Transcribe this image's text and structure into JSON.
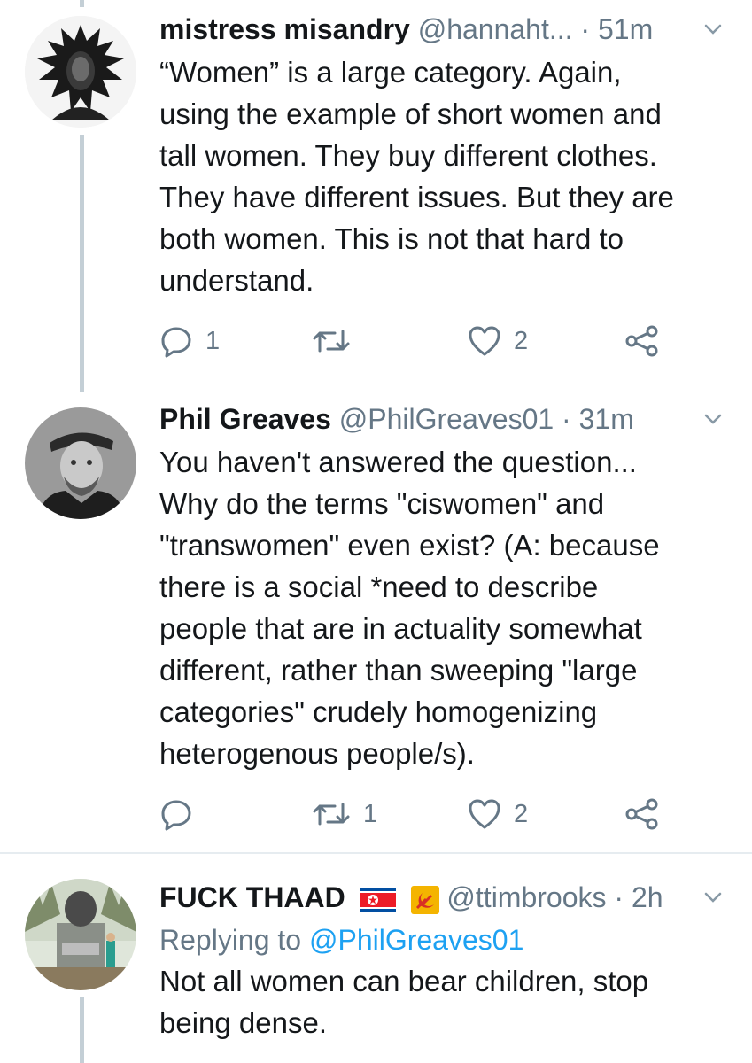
{
  "tweets": [
    {
      "name": "mistress misandry",
      "handle": "@hannaht...",
      "time": "51m",
      "text": "“Women” is a large category. Again,\nusing the example of short women and\ntall women. They buy different clothes.\nThey have different issues. But they are\nboth women. This is not that hard to\nunderstand.",
      "reply_count": "1",
      "retweet_count": "",
      "like_count": "2"
    },
    {
      "name": "Phil Greaves",
      "handle": "@PhilGreaves01",
      "time": "31m",
      "text": "You haven't answered the question...\nWhy do the terms \"ciswomen\" and\n\"transwomen\" even exist? (A: because\nthere is a social *need to describe\npeople that are in actuality somewhat\ndifferent, rather than sweeping \"large\ncategories\" crudely homogenizing\nheterogenous people/s).",
      "reply_count": "",
      "retweet_count": "1",
      "like_count": "2"
    },
    {
      "name": "FUCK THAAD",
      "handle": "@ttimbrooks",
      "time": "2h",
      "replying_prefix": "Replying to",
      "replying_to": "@PhilGreaves01",
      "text": "Not all women can bear children, stop\nbeing dense."
    }
  ],
  "separator": "·",
  "icons": {
    "reply": "reply-icon",
    "retweet": "retweet-icon",
    "like": "heart-icon",
    "share": "share-icon",
    "more": "chevron-down-icon"
  },
  "colors": {
    "text": "#14171a",
    "muted": "#657786",
    "link": "#1da1f2",
    "thread_line": "#c4cfd6"
  }
}
